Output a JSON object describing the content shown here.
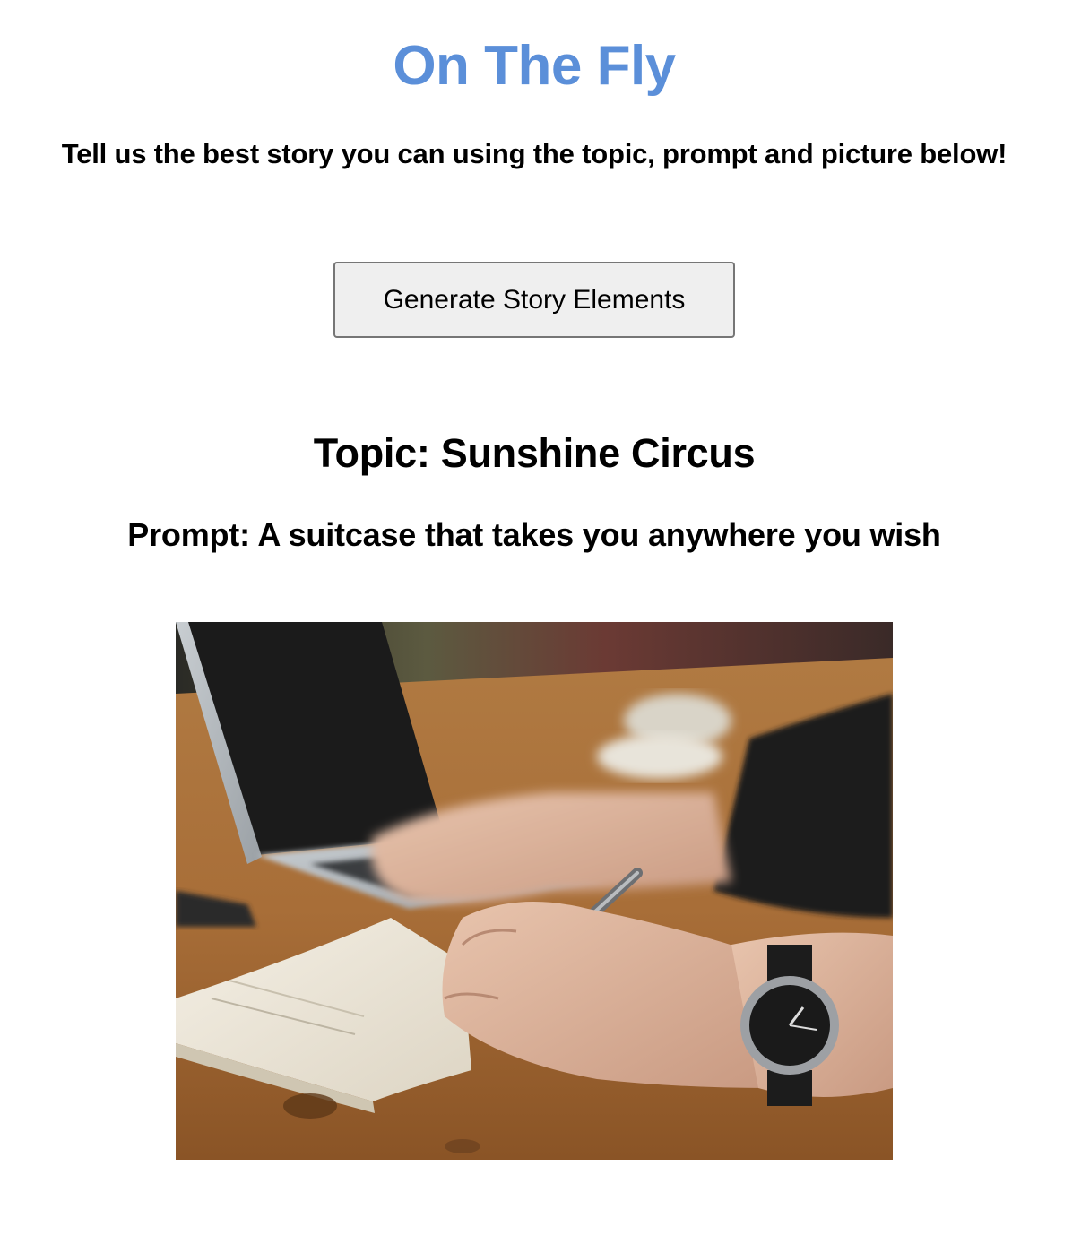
{
  "header": {
    "title": "On The Fly",
    "instructions": "Tell us the best story you can using the topic, prompt and picture below!"
  },
  "controls": {
    "generate_label": "Generate Story Elements"
  },
  "story": {
    "topic": "Topic: Sunshine Circus",
    "prompt": "Prompt: A suitcase that takes you anywhere you wish",
    "picture": {
      "subject": "photo-hand-writing-in-notebook-beside-laptop"
    }
  },
  "colors": {
    "title": "#5b8fd9",
    "button_bg": "#efefef",
    "button_border": "#767676"
  }
}
